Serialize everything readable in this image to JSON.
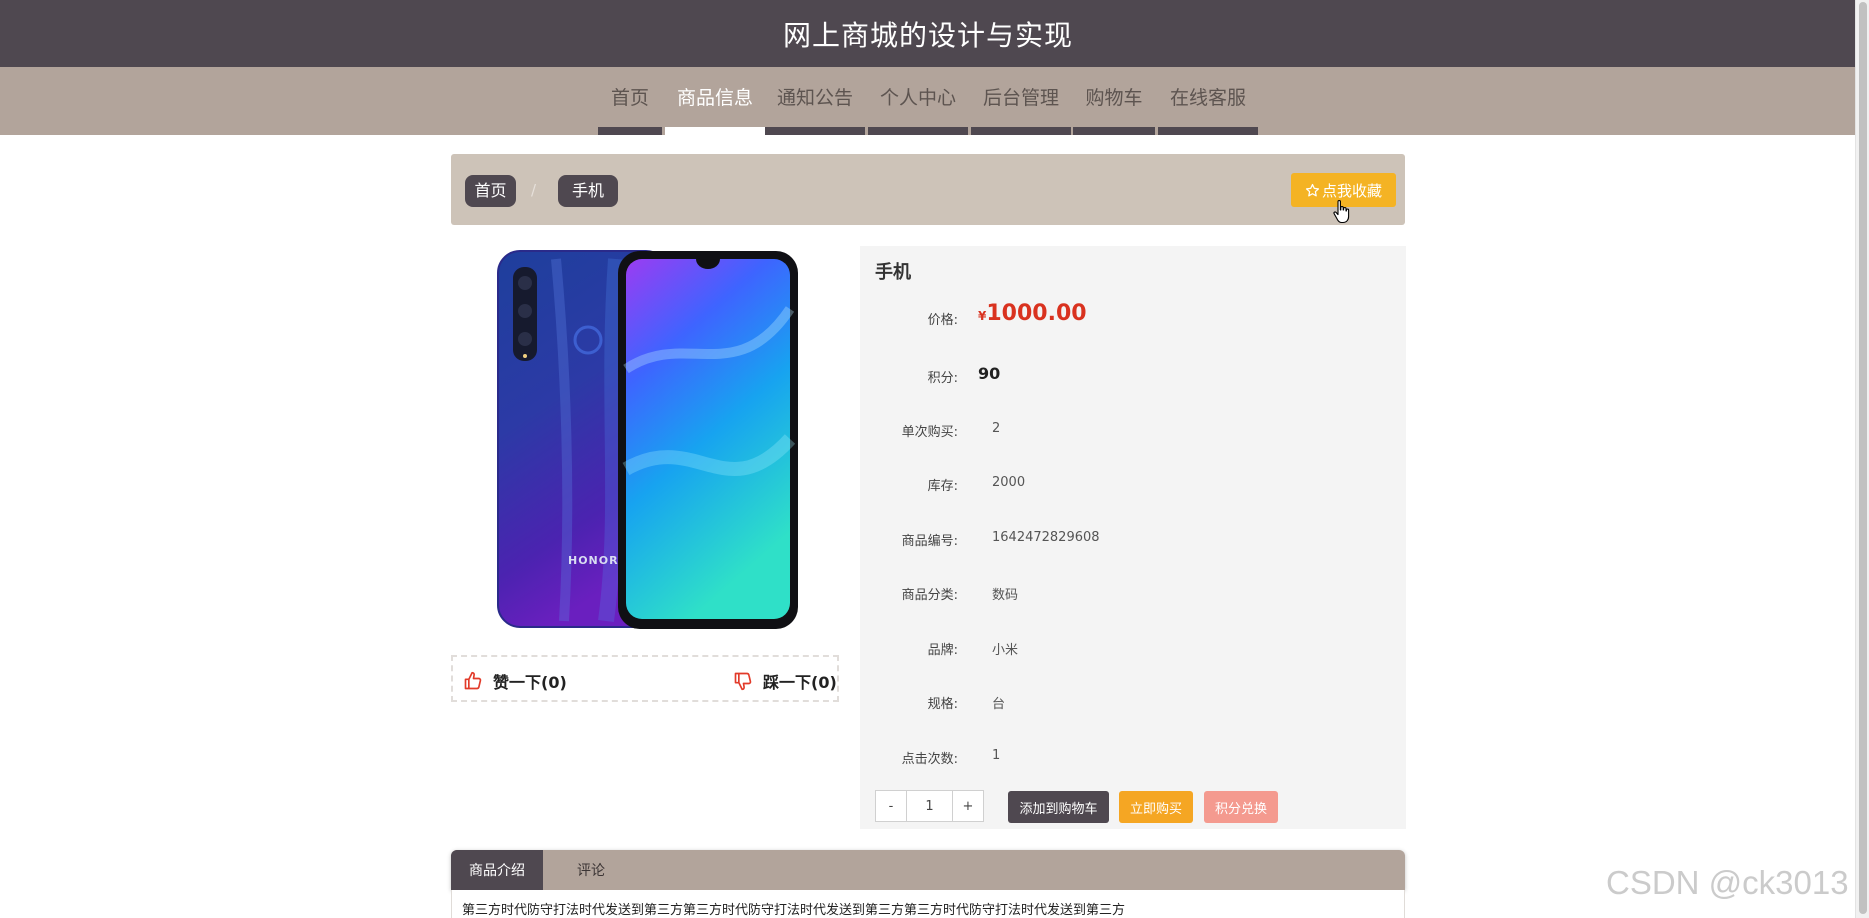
{
  "header": {
    "title": "网上商城的设计与实现"
  },
  "nav": {
    "items": [
      {
        "label": "首页"
      },
      {
        "label": "商品信息"
      },
      {
        "label": "通知公告"
      },
      {
        "label": "个人中心"
      },
      {
        "label": "后台管理"
      },
      {
        "label": "购物车"
      },
      {
        "label": "在线客服"
      }
    ],
    "active_index": 1
  },
  "breadcrumb": {
    "items": [
      {
        "label": "首页"
      },
      {
        "label": "手机"
      }
    ],
    "separator": "/"
  },
  "favorite_button": {
    "label": "点我收藏",
    "icon": "star-outline-icon",
    "color": "#f4b324"
  },
  "product": {
    "name": "手机",
    "image_brand_text": "HONOR",
    "price_label": "价格:",
    "currency": "¥",
    "price": "1000.00",
    "points_label": "积分:",
    "points": "90",
    "details": [
      {
        "label": "单次购买:",
        "value": "2"
      },
      {
        "label": "库存:",
        "value": "2000"
      },
      {
        "label": "商品编号:",
        "value": "1642472829608"
      },
      {
        "label": "商品分类:",
        "value": "数码"
      },
      {
        "label": "品牌:",
        "value": "小米"
      },
      {
        "label": "规格:",
        "value": "台"
      },
      {
        "label": "点击次数:",
        "value": "1"
      }
    ]
  },
  "votes": {
    "like_label": "赞一下(0)",
    "like_icon": "thumbs-up-icon",
    "dislike_label": "踩一下(0)",
    "dislike_icon": "thumbs-down-icon"
  },
  "purchase": {
    "decrement": "-",
    "quantity": "1",
    "increment": "+",
    "add_to_cart": "添加到购物车",
    "buy_now": "立即购买",
    "points_exchange": "积分兑换"
  },
  "tabs": {
    "items": [
      {
        "label": "商品介绍"
      },
      {
        "label": "评论"
      }
    ],
    "active_index": 0
  },
  "description": "第三方时代防守打法时代发送到第三方第三方时代防守打法时代发送到第三方第三方时代防守打法时代发送到第三方",
  "watermark": "CSDN @ck3013",
  "colors": {
    "header_bg": "#4f4850",
    "nav_bg": "#b2a49b",
    "breadcrumb_bg": "#cdc3b8",
    "price": "#d9321f",
    "add_to_cart": "#4f4850",
    "buy_now": "#f5a623",
    "points_exchange": "#f49a8f"
  }
}
